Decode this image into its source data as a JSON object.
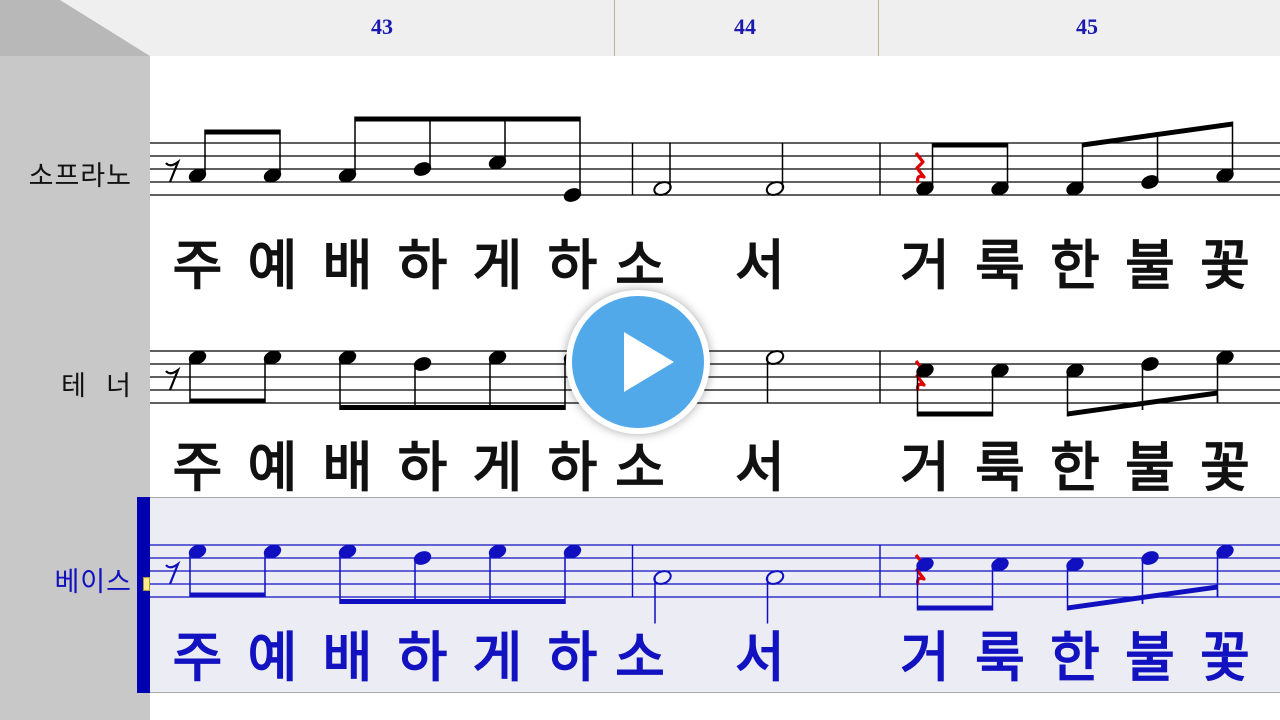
{
  "ruler": {
    "measures": [
      {
        "number": "43",
        "beat": 2
      },
      {
        "number": "44",
        "beat": 5
      },
      {
        "number": "45",
        "beat": 9
      }
    ]
  },
  "staves": [
    {
      "id": "soprano",
      "label": "소프라노",
      "selected": false,
      "color": "#000000",
      "lyrics": [
        "주",
        "예",
        "배",
        "하",
        "게",
        "하",
        "소",
        "서",
        "거",
        "룩",
        "한",
        "불",
        "꽃"
      ],
      "notes": [
        {
          "beat": 0.9,
          "step": -1,
          "type": "eighth",
          "stem": "up",
          "beam": "a"
        },
        {
          "beat": 1.9,
          "step": -1,
          "type": "eighth",
          "stem": "up",
          "beam": "a"
        },
        {
          "beat": 2.9,
          "step": -1,
          "type": "eighth",
          "stem": "up",
          "beam": "b"
        },
        {
          "beat": 3.9,
          "step": 0,
          "type": "eighth",
          "stem": "up",
          "beam": "b"
        },
        {
          "beat": 4.9,
          "step": 1,
          "type": "eighth",
          "stem": "up",
          "beam": "b"
        },
        {
          "beat": 5.9,
          "step": -4,
          "type": "eighth",
          "stem": "up",
          "beam": "b"
        },
        {
          "beat": 7.1,
          "step": -3,
          "type": "half",
          "stem": "up"
        },
        {
          "beat": 8.6,
          "step": -3,
          "type": "half",
          "stem": "up"
        },
        {
          "beat": 10.6,
          "step": -3,
          "type": "eighth",
          "stem": "up",
          "beam": "c"
        },
        {
          "beat": 11.6,
          "step": -3,
          "type": "eighth",
          "stem": "up",
          "beam": "c"
        },
        {
          "beat": 12.6,
          "step": -3,
          "type": "eighth",
          "stem": "up",
          "beam": "d"
        },
        {
          "beat": 13.6,
          "step": -2,
          "type": "eighth",
          "stem": "up",
          "beam": "d"
        },
        {
          "beat": 14.6,
          "step": -1,
          "type": "eighth",
          "stem": "up",
          "beam": "d"
        }
      ]
    },
    {
      "id": "tenor",
      "label": "테  너",
      "selected": false,
      "color": "#000000",
      "lyrics": [
        "주",
        "예",
        "배",
        "하",
        "게",
        "하",
        "소",
        "서",
        "거",
        "룩",
        "한",
        "불",
        "꽃"
      ],
      "notes": [
        {
          "beat": 0.9,
          "step": 3,
          "type": "eighth",
          "stem": "down",
          "beam": "a"
        },
        {
          "beat": 1.9,
          "step": 3,
          "type": "eighth",
          "stem": "down",
          "beam": "a"
        },
        {
          "beat": 2.9,
          "step": 3,
          "type": "eighth",
          "stem": "down",
          "beam": "b"
        },
        {
          "beat": 3.9,
          "step": 2,
          "type": "eighth",
          "stem": "down",
          "beam": "b"
        },
        {
          "beat": 4.9,
          "step": 3,
          "type": "eighth",
          "stem": "down",
          "beam": "b"
        },
        {
          "beat": 5.9,
          "step": 3,
          "type": "eighth",
          "stem": "down",
          "beam": "b"
        },
        {
          "beat": 7.1,
          "step": 3,
          "type": "half",
          "stem": "down"
        },
        {
          "beat": 8.6,
          "step": 3,
          "type": "half",
          "stem": "down"
        },
        {
          "beat": 10.6,
          "step": 1,
          "type": "eighth",
          "stem": "down",
          "beam": "c"
        },
        {
          "beat": 11.6,
          "step": 1,
          "type": "eighth",
          "stem": "down",
          "beam": "c"
        },
        {
          "beat": 12.6,
          "step": 1,
          "type": "eighth",
          "stem": "down",
          "beam": "d"
        },
        {
          "beat": 13.6,
          "step": 2,
          "type": "eighth",
          "stem": "down",
          "beam": "d"
        },
        {
          "beat": 14.6,
          "step": 3,
          "type": "eighth",
          "stem": "down",
          "beam": "d"
        }
      ]
    },
    {
      "id": "bass",
      "label": "베이스",
      "selected": true,
      "color": "#1010c0",
      "lyrics": [
        "주",
        "예",
        "배",
        "하",
        "게",
        "하",
        "소",
        "서",
        "거",
        "룩",
        "한",
        "불",
        "꽃"
      ],
      "notes": [
        {
          "beat": 0.9,
          "step": 3,
          "type": "eighth",
          "stem": "down",
          "beam": "a"
        },
        {
          "beat": 1.9,
          "step": 3,
          "type": "eighth",
          "stem": "down",
          "beam": "a"
        },
        {
          "beat": 2.9,
          "step": 3,
          "type": "eighth",
          "stem": "down",
          "beam": "b"
        },
        {
          "beat": 3.9,
          "step": 2,
          "type": "eighth",
          "stem": "down",
          "beam": "b"
        },
        {
          "beat": 4.9,
          "step": 3,
          "type": "eighth",
          "stem": "down",
          "beam": "b"
        },
        {
          "beat": 5.9,
          "step": 3,
          "type": "eighth",
          "stem": "down",
          "beam": "b"
        },
        {
          "beat": 7.1,
          "step": -1,
          "type": "half",
          "stem": "down"
        },
        {
          "beat": 8.6,
          "step": -1,
          "type": "half",
          "stem": "down"
        },
        {
          "beat": 10.6,
          "step": 1,
          "type": "eighth",
          "stem": "down",
          "beam": "c"
        },
        {
          "beat": 11.6,
          "step": 1,
          "type": "eighth",
          "stem": "down",
          "beam": "c"
        },
        {
          "beat": 12.6,
          "step": 1,
          "type": "eighth",
          "stem": "down",
          "beam": "d"
        },
        {
          "beat": 13.6,
          "step": 2,
          "type": "eighth",
          "stem": "down",
          "beam": "d"
        },
        {
          "beat": 14.6,
          "step": 3,
          "type": "eighth",
          "stem": "down",
          "beam": "d"
        }
      ]
    }
  ],
  "barlines": [
    6.7,
    10.0
  ],
  "rest_color": "#e00000",
  "play_button": {
    "icon": "play-icon",
    "color": "#52a9ea"
  }
}
